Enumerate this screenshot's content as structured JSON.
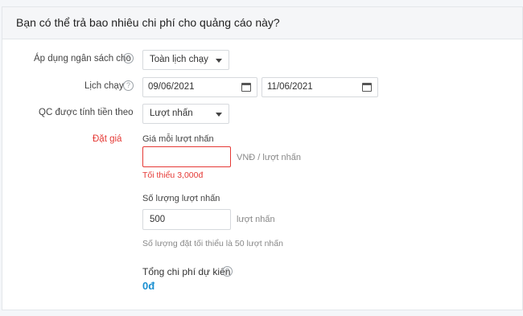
{
  "header": {
    "title": "Bạn có thể trả bao nhiêu chi phí cho quảng cáo này?"
  },
  "budget": {
    "label": "Áp dụng ngân sách cho",
    "value": "Toàn lịch chạy"
  },
  "schedule": {
    "label": "Lịch chạy",
    "start_date": "09/06/2021",
    "end_date": "11/06/2021"
  },
  "billing": {
    "label": "QC được tính tiền theo",
    "value": "Lượt nhấn"
  },
  "bid": {
    "label": "Đặt giá",
    "price_label": "Giá mỗi lượt nhấn",
    "price_value": "",
    "price_unit": "VNĐ / lượt nhấn",
    "price_error": "Tối thiểu 3,000đ",
    "qty_label": "Số lượng lượt nhấn",
    "qty_value": "500",
    "qty_unit": "lượt nhấn",
    "qty_hint": "Số lượng đặt tối thiểu là 50 lượt nhấn"
  },
  "total": {
    "label": "Tổng chi phí dự kiến",
    "value": "0đ"
  },
  "colors": {
    "accent": "#1a8fd1",
    "error": "#e53935"
  }
}
